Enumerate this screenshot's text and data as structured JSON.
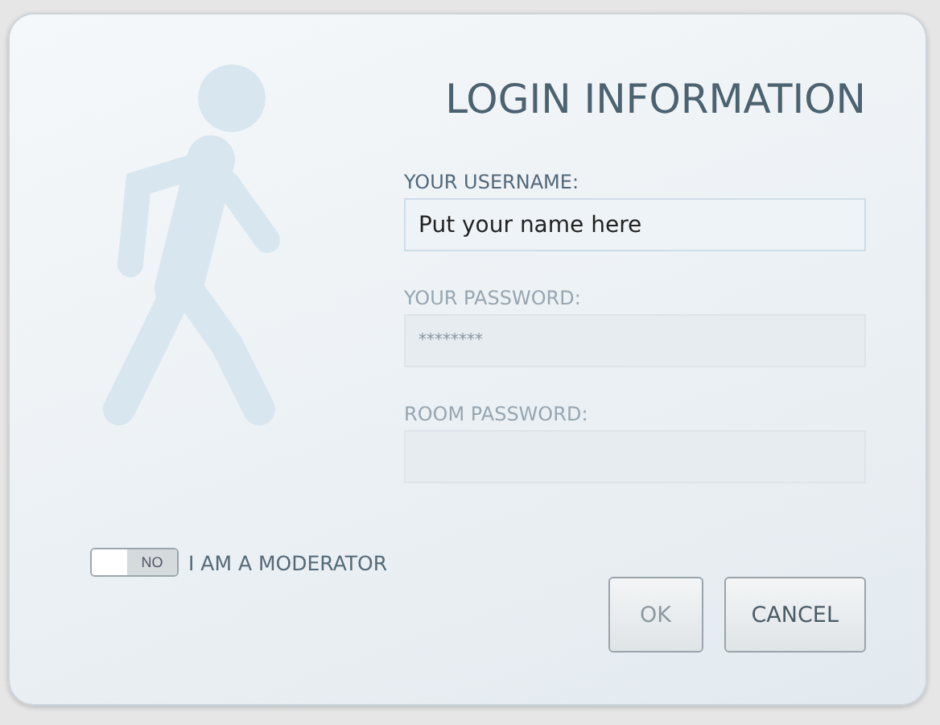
{
  "title": "LOGIN INFORMATION",
  "fields": [
    {
      "label": "YOUR USERNAME:",
      "value": "Put your name here",
      "disabled": false
    },
    {
      "label": "YOUR PASSWORD:",
      "value": "********",
      "disabled": true
    },
    {
      "label": "ROOM PASSWORD:",
      "disabled": true
    }
  ],
  "moderator_toggle": {
    "state_text": "NO",
    "on": false,
    "label": "I AM A MODERATOR"
  },
  "buttons": [
    {
      "label": "OK",
      "disabled": true
    },
    {
      "label": "CANCEL",
      "disabled": false
    }
  ]
}
